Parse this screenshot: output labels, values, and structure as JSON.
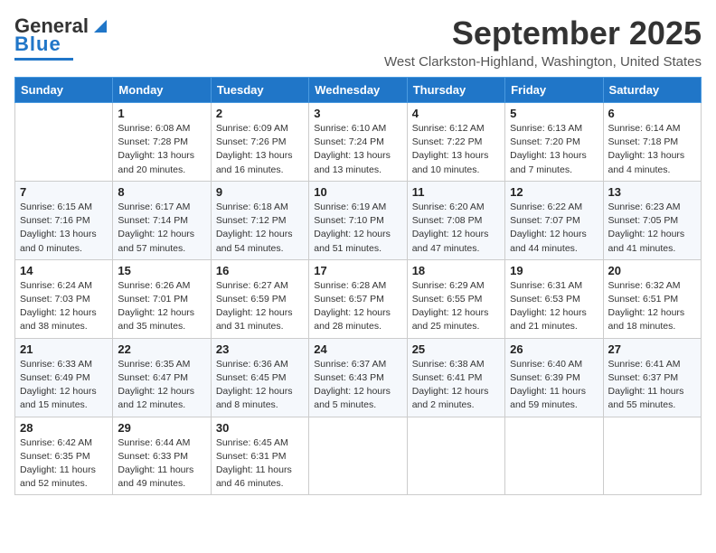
{
  "header": {
    "logo_general": "General",
    "logo_blue": "Blue",
    "month_title": "September 2025",
    "location": "West Clarkston-Highland, Washington, United States"
  },
  "weekdays": [
    "Sunday",
    "Monday",
    "Tuesday",
    "Wednesday",
    "Thursday",
    "Friday",
    "Saturday"
  ],
  "weeks": [
    [
      {
        "day": "",
        "sunrise": "",
        "sunset": "",
        "daylight": ""
      },
      {
        "day": "1",
        "sunrise": "Sunrise: 6:08 AM",
        "sunset": "Sunset: 7:28 PM",
        "daylight": "Daylight: 13 hours and 20 minutes."
      },
      {
        "day": "2",
        "sunrise": "Sunrise: 6:09 AM",
        "sunset": "Sunset: 7:26 PM",
        "daylight": "Daylight: 13 hours and 16 minutes."
      },
      {
        "day": "3",
        "sunrise": "Sunrise: 6:10 AM",
        "sunset": "Sunset: 7:24 PM",
        "daylight": "Daylight: 13 hours and 13 minutes."
      },
      {
        "day": "4",
        "sunrise": "Sunrise: 6:12 AM",
        "sunset": "Sunset: 7:22 PM",
        "daylight": "Daylight: 13 hours and 10 minutes."
      },
      {
        "day": "5",
        "sunrise": "Sunrise: 6:13 AM",
        "sunset": "Sunset: 7:20 PM",
        "daylight": "Daylight: 13 hours and 7 minutes."
      },
      {
        "day": "6",
        "sunrise": "Sunrise: 6:14 AM",
        "sunset": "Sunset: 7:18 PM",
        "daylight": "Daylight: 13 hours and 4 minutes."
      }
    ],
    [
      {
        "day": "7",
        "sunrise": "Sunrise: 6:15 AM",
        "sunset": "Sunset: 7:16 PM",
        "daylight": "Daylight: 13 hours and 0 minutes."
      },
      {
        "day": "8",
        "sunrise": "Sunrise: 6:17 AM",
        "sunset": "Sunset: 7:14 PM",
        "daylight": "Daylight: 12 hours and 57 minutes."
      },
      {
        "day": "9",
        "sunrise": "Sunrise: 6:18 AM",
        "sunset": "Sunset: 7:12 PM",
        "daylight": "Daylight: 12 hours and 54 minutes."
      },
      {
        "day": "10",
        "sunrise": "Sunrise: 6:19 AM",
        "sunset": "Sunset: 7:10 PM",
        "daylight": "Daylight: 12 hours and 51 minutes."
      },
      {
        "day": "11",
        "sunrise": "Sunrise: 6:20 AM",
        "sunset": "Sunset: 7:08 PM",
        "daylight": "Daylight: 12 hours and 47 minutes."
      },
      {
        "day": "12",
        "sunrise": "Sunrise: 6:22 AM",
        "sunset": "Sunset: 7:07 PM",
        "daylight": "Daylight: 12 hours and 44 minutes."
      },
      {
        "day": "13",
        "sunrise": "Sunrise: 6:23 AM",
        "sunset": "Sunset: 7:05 PM",
        "daylight": "Daylight: 12 hours and 41 minutes."
      }
    ],
    [
      {
        "day": "14",
        "sunrise": "Sunrise: 6:24 AM",
        "sunset": "Sunset: 7:03 PM",
        "daylight": "Daylight: 12 hours and 38 minutes."
      },
      {
        "day": "15",
        "sunrise": "Sunrise: 6:26 AM",
        "sunset": "Sunset: 7:01 PM",
        "daylight": "Daylight: 12 hours and 35 minutes."
      },
      {
        "day": "16",
        "sunrise": "Sunrise: 6:27 AM",
        "sunset": "Sunset: 6:59 PM",
        "daylight": "Daylight: 12 hours and 31 minutes."
      },
      {
        "day": "17",
        "sunrise": "Sunrise: 6:28 AM",
        "sunset": "Sunset: 6:57 PM",
        "daylight": "Daylight: 12 hours and 28 minutes."
      },
      {
        "day": "18",
        "sunrise": "Sunrise: 6:29 AM",
        "sunset": "Sunset: 6:55 PM",
        "daylight": "Daylight: 12 hours and 25 minutes."
      },
      {
        "day": "19",
        "sunrise": "Sunrise: 6:31 AM",
        "sunset": "Sunset: 6:53 PM",
        "daylight": "Daylight: 12 hours and 21 minutes."
      },
      {
        "day": "20",
        "sunrise": "Sunrise: 6:32 AM",
        "sunset": "Sunset: 6:51 PM",
        "daylight": "Daylight: 12 hours and 18 minutes."
      }
    ],
    [
      {
        "day": "21",
        "sunrise": "Sunrise: 6:33 AM",
        "sunset": "Sunset: 6:49 PM",
        "daylight": "Daylight: 12 hours and 15 minutes."
      },
      {
        "day": "22",
        "sunrise": "Sunrise: 6:35 AM",
        "sunset": "Sunset: 6:47 PM",
        "daylight": "Daylight: 12 hours and 12 minutes."
      },
      {
        "day": "23",
        "sunrise": "Sunrise: 6:36 AM",
        "sunset": "Sunset: 6:45 PM",
        "daylight": "Daylight: 12 hours and 8 minutes."
      },
      {
        "day": "24",
        "sunrise": "Sunrise: 6:37 AM",
        "sunset": "Sunset: 6:43 PM",
        "daylight": "Daylight: 12 hours and 5 minutes."
      },
      {
        "day": "25",
        "sunrise": "Sunrise: 6:38 AM",
        "sunset": "Sunset: 6:41 PM",
        "daylight": "Daylight: 12 hours and 2 minutes."
      },
      {
        "day": "26",
        "sunrise": "Sunrise: 6:40 AM",
        "sunset": "Sunset: 6:39 PM",
        "daylight": "Daylight: 11 hours and 59 minutes."
      },
      {
        "day": "27",
        "sunrise": "Sunrise: 6:41 AM",
        "sunset": "Sunset: 6:37 PM",
        "daylight": "Daylight: 11 hours and 55 minutes."
      }
    ],
    [
      {
        "day": "28",
        "sunrise": "Sunrise: 6:42 AM",
        "sunset": "Sunset: 6:35 PM",
        "daylight": "Daylight: 11 hours and 52 minutes."
      },
      {
        "day": "29",
        "sunrise": "Sunrise: 6:44 AM",
        "sunset": "Sunset: 6:33 PM",
        "daylight": "Daylight: 11 hours and 49 minutes."
      },
      {
        "day": "30",
        "sunrise": "Sunrise: 6:45 AM",
        "sunset": "Sunset: 6:31 PM",
        "daylight": "Daylight: 11 hours and 46 minutes."
      },
      {
        "day": "",
        "sunrise": "",
        "sunset": "",
        "daylight": ""
      },
      {
        "day": "",
        "sunrise": "",
        "sunset": "",
        "daylight": ""
      },
      {
        "day": "",
        "sunrise": "",
        "sunset": "",
        "daylight": ""
      },
      {
        "day": "",
        "sunrise": "",
        "sunset": "",
        "daylight": ""
      }
    ]
  ]
}
